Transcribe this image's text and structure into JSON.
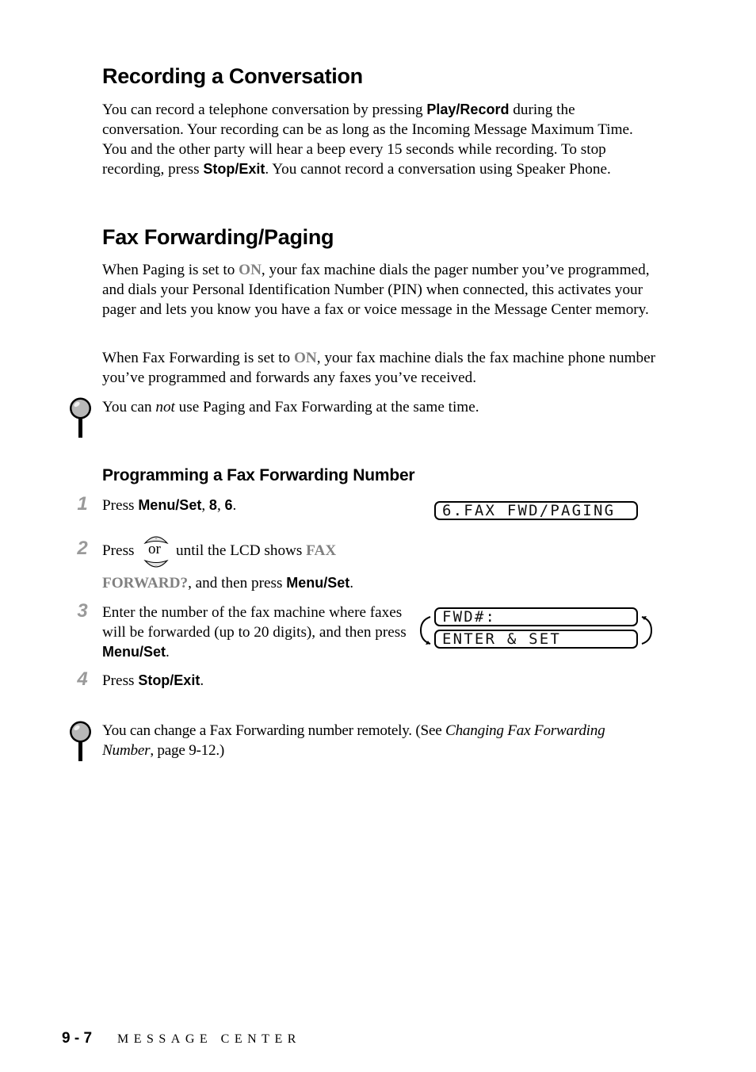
{
  "section1": {
    "title": "Recording a Conversation",
    "para": {
      "t1": "You can record a telephone conversation by pressing ",
      "k1": "Play/Record",
      "t2": " during the conversation. Your recording can be as long as the Incoming Message Maximum Time. You and the other party will hear a beep every 15 seconds while recording. To stop recording, press ",
      "k2": "Stop/Exit",
      "t3": ". You cannot record a conversation using Speaker Phone."
    }
  },
  "section2": {
    "title": "Fax Forwarding/Paging",
    "para1": {
      "t1": "When Paging is set to ",
      "on": "ON",
      "t2": ", your fax machine dials the pager number you’ve programmed, and dials your Personal Identification Number (PIN) when connected, this activates your pager and lets you know you have a fax or voice message in the Message Center memory."
    },
    "para2": {
      "t1": "When Fax Forwarding is set to ",
      "on": "ON",
      "t2": ", your fax machine dials the fax machine phone number you’ve programmed and forwards any faxes you’ve received."
    },
    "note": {
      "icon": "magnifier-note-icon",
      "t1": "You can ",
      "em": "not",
      "t2": " use Paging and Fax Forwarding at the same time."
    }
  },
  "subsection": {
    "title": "Programming a Fax Forwarding Number",
    "steps": [
      {
        "num": "1",
        "t1": "Press ",
        "k1": "Menu/Set",
        "t2": ", ",
        "k2": "8",
        "t3": ", ",
        "k3": "6",
        "t4": "."
      },
      {
        "num": "2",
        "t1": "Press ",
        "or": "or",
        "t2": " until the LCD shows ",
        "lcd1": "FAX",
        "lcd2": "FORWARD?",
        "t3": ", and then press ",
        "k1": "Menu/Set",
        "t4": "."
      },
      {
        "num": "3",
        "t1": "Enter the number of the fax machine where faxes will be forwarded (up to 20 digits), and then press ",
        "k1": "Menu/Set",
        "t2": "."
      },
      {
        "num": "4",
        "t1": "Press ",
        "k1": "Stop/Exit",
        "t2": "."
      }
    ],
    "lcd_screens": {
      "screen1": "6.FAX FWD/PAGING",
      "screen2_line1": "FWD#:",
      "screen2_line2": "ENTER & SET"
    },
    "note": {
      "icon": "magnifier-note-icon",
      "t1": "You can change a Fax Forwarding number remotely. (See ",
      "em": "Changing Fax Forwarding Number",
      "t2": ", page 9-12.)"
    }
  },
  "footer": {
    "page_number": "9 - 7",
    "section_name": "MESSAGE CENTER"
  }
}
